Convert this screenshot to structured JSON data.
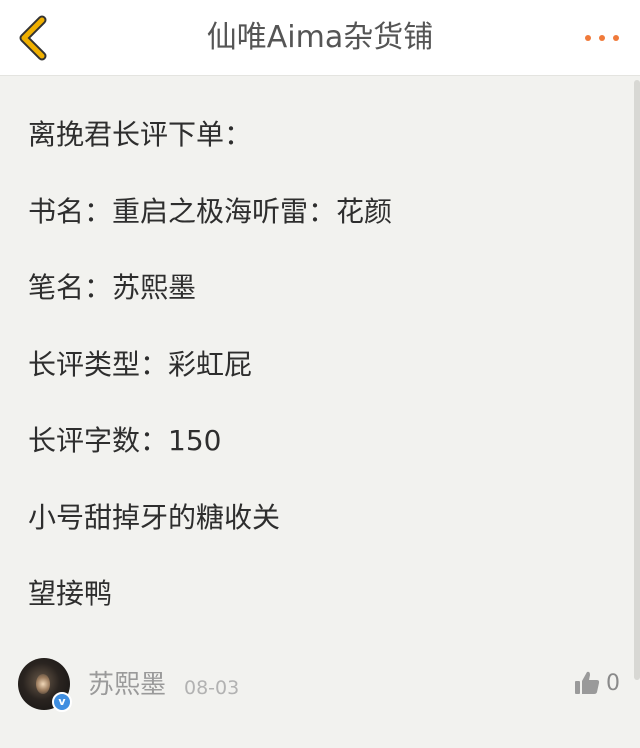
{
  "header": {
    "title": "仙唯Aima杂货铺",
    "back_icon": "chevron-left-icon",
    "more_icon": "more-dots-icon",
    "accent_color": "#f0b000",
    "more_color": "#f07a3a"
  },
  "post": {
    "lines": [
      "离挽君长评下单：",
      "书名：重启之极海听雷：花颜",
      "笔名：苏熙墨",
      "长评类型：彩虹屁",
      "长评字数：150",
      "小号甜掉牙的糖收关",
      "望接鸭"
    ]
  },
  "footer": {
    "username": "苏熙墨",
    "date": "08-03",
    "verified_mark": "v",
    "like_icon": "thumbs-up-icon",
    "like_count": "0"
  }
}
